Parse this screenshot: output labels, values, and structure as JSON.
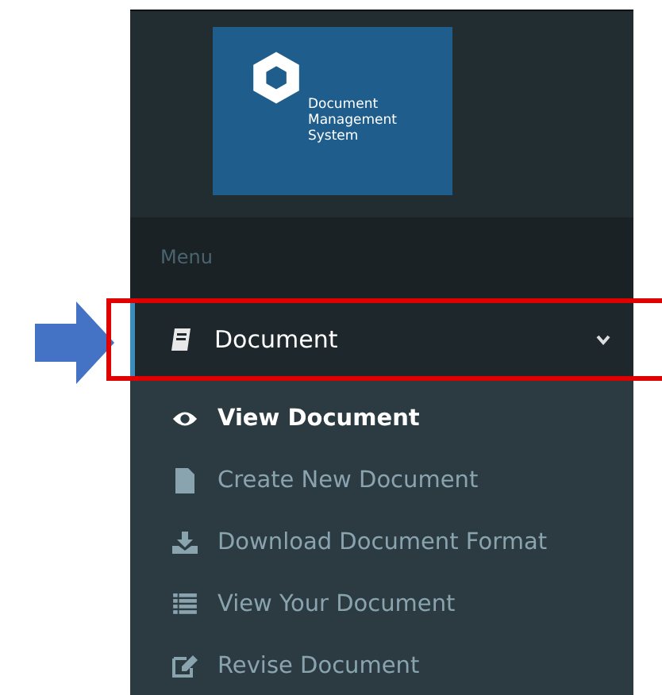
{
  "logo": {
    "text_lines": [
      "Document",
      "Management",
      "System"
    ]
  },
  "menu_header": "Menu",
  "menu": {
    "label": "Document",
    "expanded": true,
    "highlighted": true,
    "children": [
      {
        "label": "View Document",
        "selected": true
      },
      {
        "label": "Create New Document",
        "selected": false
      },
      {
        "label": "Download Document Format",
        "selected": false
      },
      {
        "label": "View Your Document",
        "selected": false
      },
      {
        "label": "Revise Document",
        "selected": false
      }
    ]
  }
}
